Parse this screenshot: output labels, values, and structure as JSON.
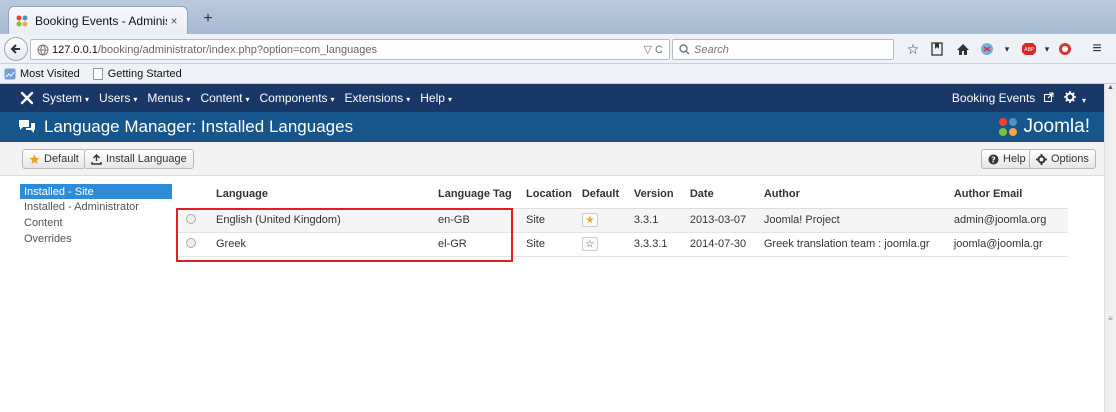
{
  "browser": {
    "tab_title": "Booking Events - Administ...",
    "tab_close": "×",
    "new_tab": "+",
    "url_host": "127.0.0.1",
    "url_path": "/booking/administrator/index.php?option=com_languages",
    "url_icons": "▽ C",
    "search_placeholder": "Search",
    "bookmarks": [
      "Most Visited",
      "Getting Started"
    ]
  },
  "joomla_menu": {
    "items": [
      "System",
      "Users",
      "Menus",
      "Content",
      "Components",
      "Extensions",
      "Help"
    ],
    "site_link": "Booking Events",
    "settings_caret": "▾"
  },
  "title_bar": {
    "title": "Language Manager: Installed Languages",
    "brand": "Joomla!"
  },
  "toolbar": {
    "default_label": "Default",
    "install_label": "Install Language",
    "help_label": "Help",
    "options_label": "Options"
  },
  "sidebar": {
    "items": [
      "Installed - Site",
      "Installed - Administrator",
      "Content",
      "Overrides"
    ]
  },
  "table": {
    "headers": [
      "Language",
      "Language Tag",
      "Location",
      "Default",
      "Version",
      "Date",
      "Author",
      "Author Email"
    ],
    "rows": [
      {
        "language": "English (United Kingdom)",
        "tag": "en-GB",
        "location": "Site",
        "default": true,
        "version": "3.3.1",
        "date": "2013-03-07",
        "author": "Joomla! Project",
        "email": "admin@joomla.org"
      },
      {
        "language": "Greek",
        "tag": "el-GR",
        "location": "Site",
        "default": false,
        "version": "3.3.3.1",
        "date": "2014-07-30",
        "author": "Greek translation team : joomla.gr",
        "email": "joomla@joomla.gr"
      }
    ]
  },
  "colors": {
    "menu_bg": "#1a3867",
    "title_bg": "#17568c",
    "active_sidebar": "#2e8bd8",
    "highlight": "#e02020",
    "default_star": "#f0a020"
  }
}
